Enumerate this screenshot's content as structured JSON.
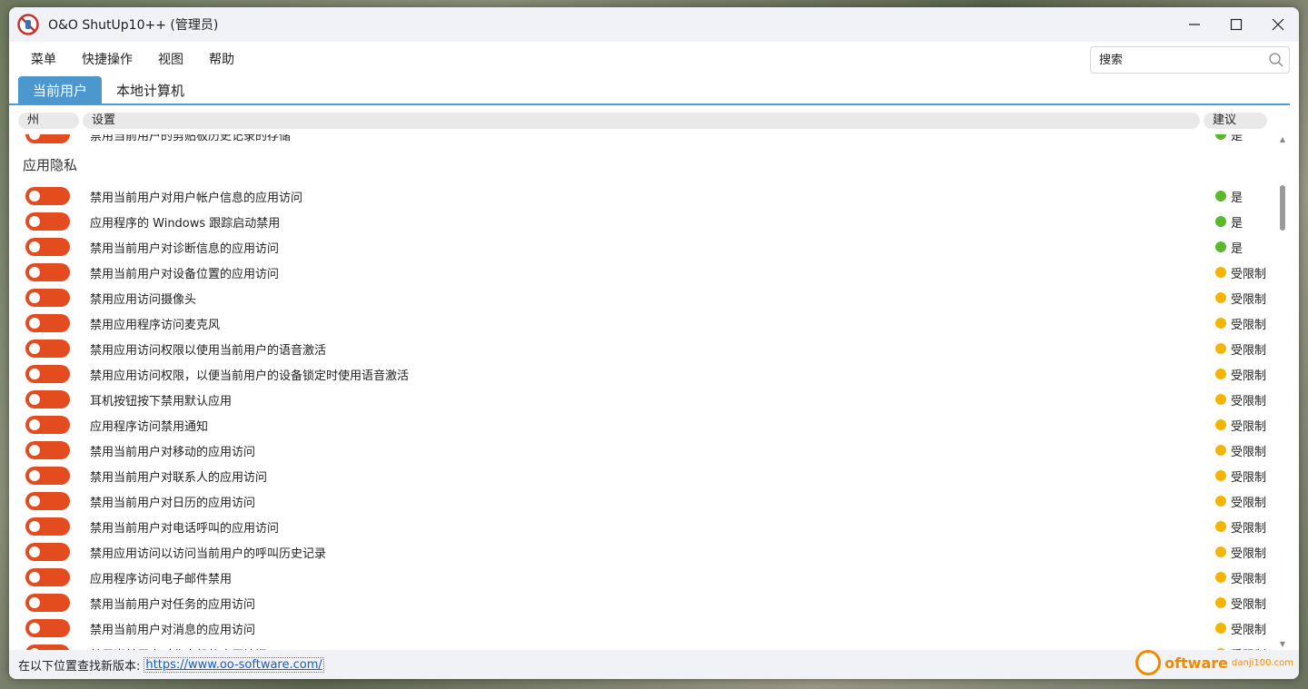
{
  "window": {
    "title": "O&O ShutUp10++ (管理员)"
  },
  "menu": [
    "菜单",
    "快捷操作",
    "视图",
    "帮助"
  ],
  "search": {
    "placeholder": "搜索"
  },
  "tabs": [
    {
      "label": "当前用户",
      "active": true
    },
    {
      "label": "本地计算机",
      "active": false
    }
  ],
  "columns": {
    "state": "州",
    "setting": "设置",
    "recommend": "建议"
  },
  "partial_row": {
    "label": "禁用当前用户的剪贴板历史记录的存储",
    "recommend": "是"
  },
  "section": {
    "title": "应用隐私"
  },
  "rows": [
    {
      "label": "禁用当前用户对用户帐户信息的应用访问",
      "recommend": "是",
      "level": "yes"
    },
    {
      "label": "应用程序的 Windows 跟踪启动禁用",
      "recommend": "是",
      "level": "yes"
    },
    {
      "label": "禁用当前用户对诊断信息的应用访问",
      "recommend": "是",
      "level": "yes"
    },
    {
      "label": "禁用当前用户对设备位置的应用访问",
      "recommend": "受限制",
      "level": "limited"
    },
    {
      "label": "禁用应用访问摄像头",
      "recommend": "受限制",
      "level": "limited"
    },
    {
      "label": "禁用应用程序访问麦克风",
      "recommend": "受限制",
      "level": "limited"
    },
    {
      "label": "禁用应用访问权限以使用当前用户的语音激活",
      "recommend": "受限制",
      "level": "limited"
    },
    {
      "label": "禁用应用访问权限，以便当前用户的设备锁定时使用语音激活",
      "recommend": "受限制",
      "level": "limited"
    },
    {
      "label": "耳机按钮按下禁用默认应用",
      "recommend": "受限制",
      "level": "limited"
    },
    {
      "label": "应用程序访问禁用通知",
      "recommend": "受限制",
      "level": "limited"
    },
    {
      "label": "禁用当前用户对移动的应用访问",
      "recommend": "受限制",
      "level": "limited"
    },
    {
      "label": "禁用当前用户对联系人的应用访问",
      "recommend": "受限制",
      "level": "limited"
    },
    {
      "label": "禁用当前用户对日历的应用访问",
      "recommend": "受限制",
      "level": "limited"
    },
    {
      "label": "禁用当前用户对电话呼叫的应用访问",
      "recommend": "受限制",
      "level": "limited"
    },
    {
      "label": "禁用应用访问以访问当前用户的呼叫历史记录",
      "recommend": "受限制",
      "level": "limited"
    },
    {
      "label": "应用程序访问电子邮件禁用",
      "recommend": "受限制",
      "level": "limited"
    },
    {
      "label": "禁用当前用户对任务的应用访问",
      "recommend": "受限制",
      "level": "limited"
    },
    {
      "label": "禁用当前用户对消息的应用访问",
      "recommend": "受限制",
      "level": "limited"
    },
    {
      "label": "禁用当前用户对收音机的应用访问",
      "recommend": "受限制",
      "level": "limited"
    }
  ],
  "colors": {
    "toggle_off": "#e34c1e",
    "yes": "#5bb82a",
    "limited": "#f5b400",
    "accent": "#4d97cf"
  },
  "status": {
    "text": "在以下位置查找新版本:",
    "link": "https://www.oo-software.com/"
  },
  "watermark": {
    "brand": "oftware",
    "site": "danji100.com"
  }
}
